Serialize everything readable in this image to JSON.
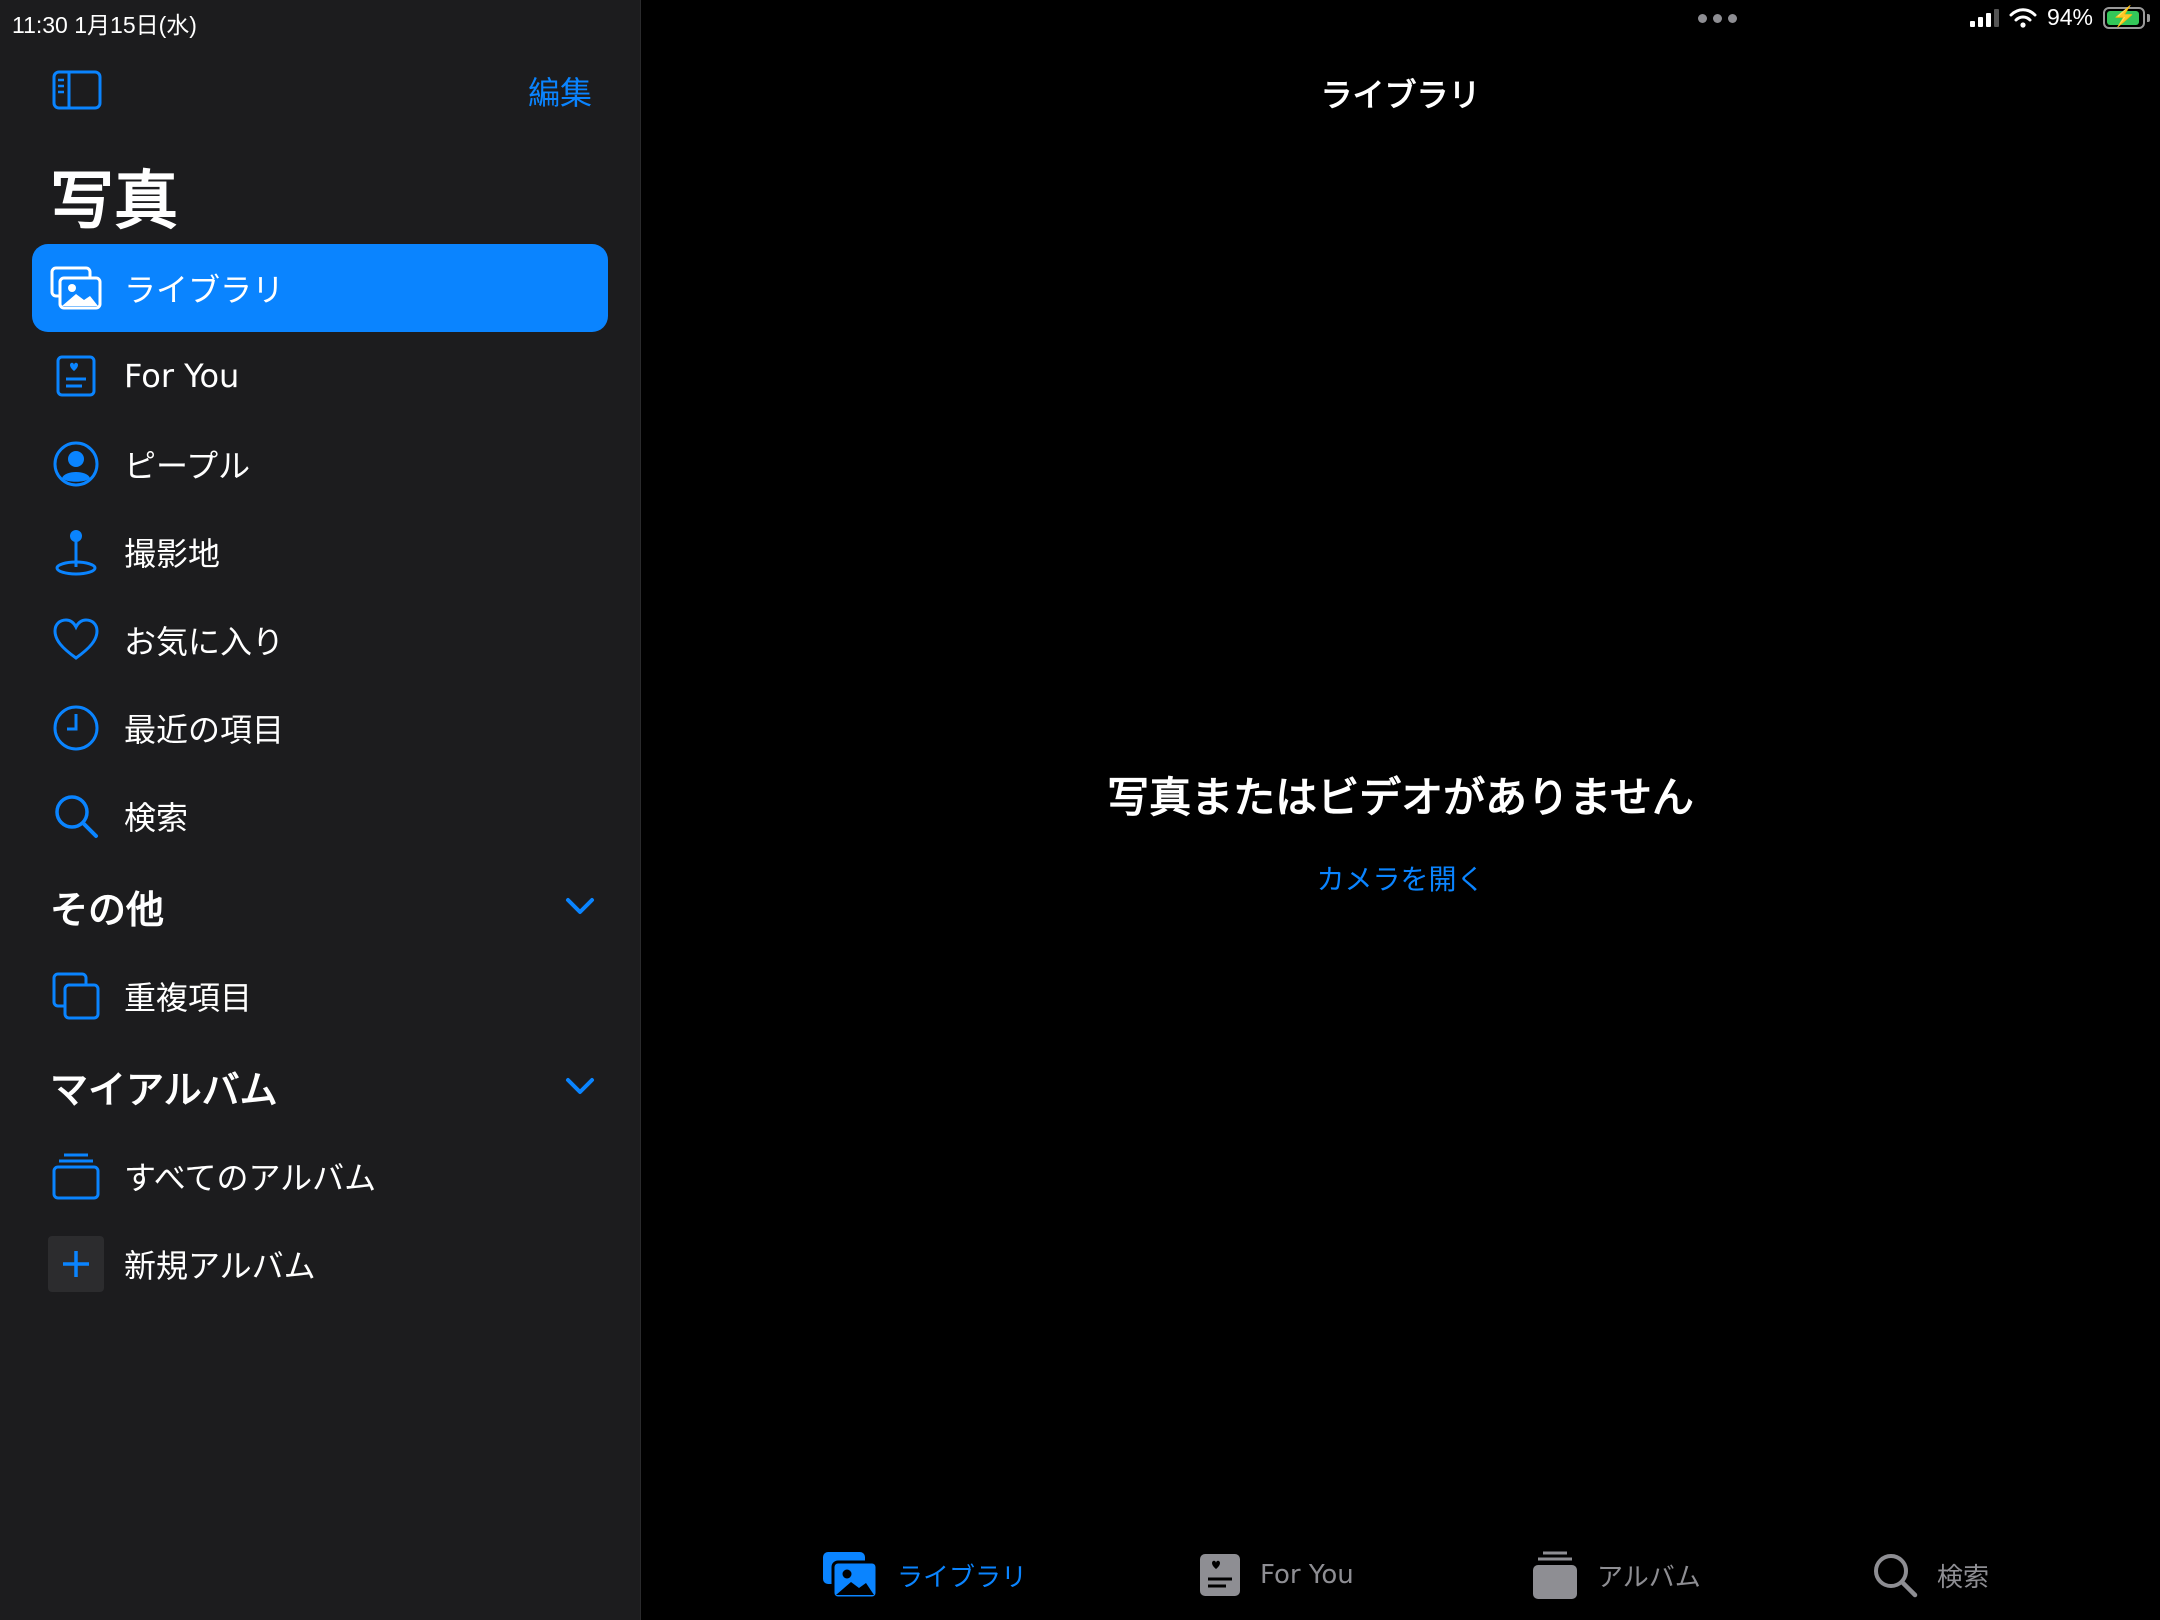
{
  "status_bar": {
    "time_date": "11:30   1月15日(水)",
    "battery": "94%",
    "battery_level": 0.94
  },
  "sidebar": {
    "edit": "編集",
    "title": "写真",
    "items": [
      {
        "label": "ライブラリ",
        "icon": "photo-library-icon",
        "selected": true
      },
      {
        "label": "For You",
        "icon": "for-you-icon"
      },
      {
        "label": "ピープル",
        "icon": "person-circle-icon"
      },
      {
        "label": "撮影地",
        "icon": "map-pin-icon"
      },
      {
        "label": "お気に入り",
        "icon": "heart-icon"
      },
      {
        "label": "最近の項目",
        "icon": "clock-icon"
      },
      {
        "label": "検索",
        "icon": "search-icon"
      }
    ],
    "other_section": {
      "title": "その他",
      "items": [
        {
          "label": "重複項目",
          "icon": "duplicates-icon"
        }
      ]
    },
    "albums_section": {
      "title": "マイアルバム",
      "items": [
        {
          "label": "すべてのアルバム",
          "icon": "albums-stack-icon"
        },
        {
          "label": "新規アルバム",
          "icon": "plus-icon"
        }
      ]
    }
  },
  "main": {
    "title": "ライブラリ",
    "empty_title": "写真またはビデオがありません",
    "open_camera": "カメラを開く"
  },
  "tab_bar": {
    "tabs": [
      {
        "label": "ライブラリ",
        "icon": "photo-library-icon",
        "active": true
      },
      {
        "label": "For You",
        "icon": "for-you-icon"
      },
      {
        "label": "アルバム",
        "icon": "albums-stack-icon"
      },
      {
        "label": "検索",
        "icon": "search-icon"
      }
    ]
  },
  "colors": {
    "accent": "#0a84ff",
    "sidebar_bg": "#1c1c1e",
    "main_bg": "#000000",
    "inactive": "#8e8e93",
    "battery_green": "#34c759"
  }
}
